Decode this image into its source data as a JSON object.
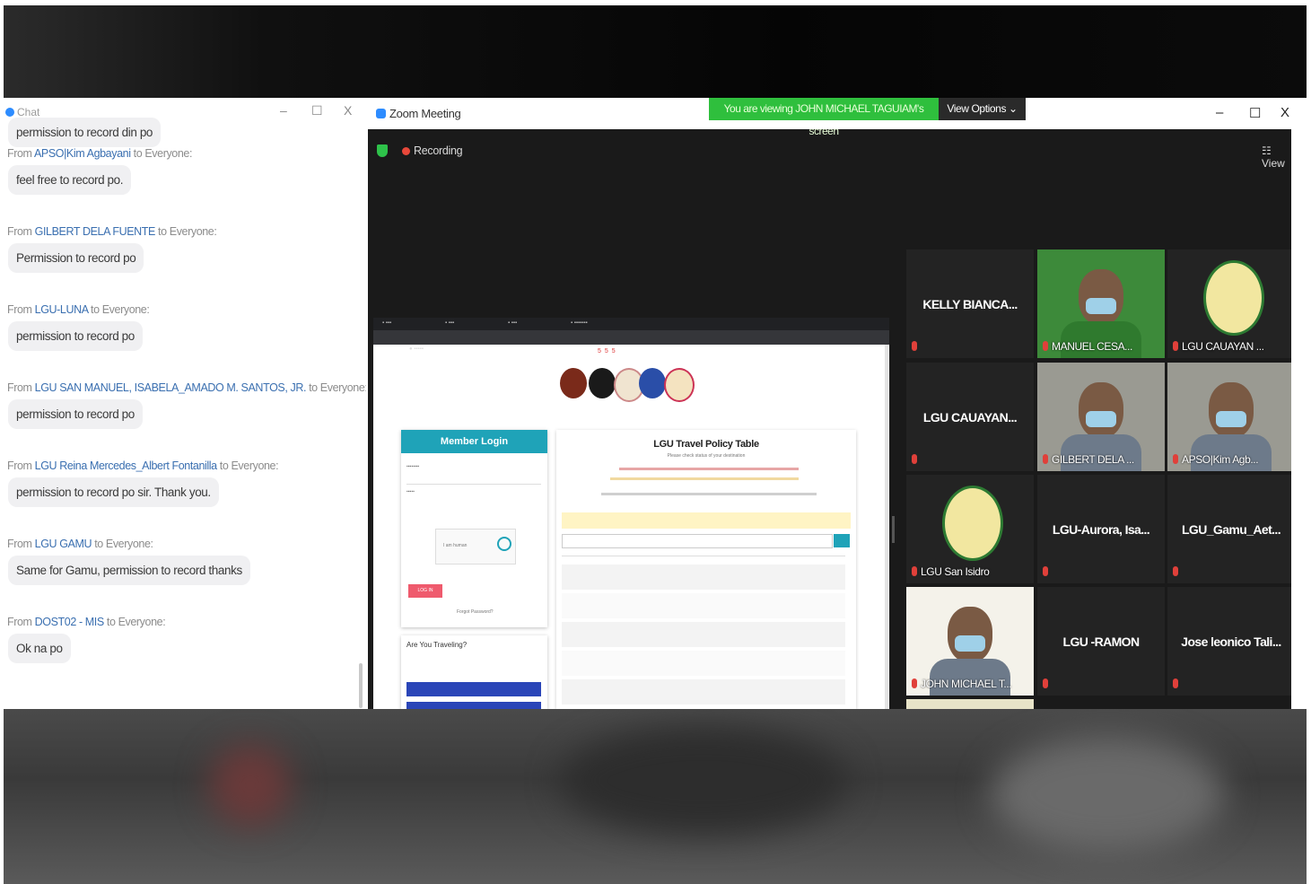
{
  "chat": {
    "title": "Chat",
    "first_bubble": "permission to record din po",
    "messages": [
      {
        "prefix": "From ",
        "sender": "APSO|Kim Agbayani",
        "suffix": " to Everyone:",
        "text": "feel free to record po."
      },
      {
        "prefix": "From ",
        "sender": "GILBERT DELA FUENTE",
        "suffix": " to Everyone:",
        "text": "Permission to record po"
      },
      {
        "prefix": "From ",
        "sender": "LGU-LUNA",
        "suffix": " to Everyone:",
        "text": "permission to record po"
      },
      {
        "prefix": "From ",
        "sender": "LGU SAN MANUEL, ISABELA_AMADO M. SANTOS, JR.",
        "suffix": " to Everyone:",
        "text": "permission to record po"
      },
      {
        "prefix": "From ",
        "sender": "LGU Reina Mercedes_Albert Fontanilla",
        "suffix": " to Everyone:",
        "text": "permission to record po sir. Thank you."
      },
      {
        "prefix": "From ",
        "sender": "LGU GAMU",
        "suffix": " to Everyone:",
        "text": "Same for Gamu, permission to record thanks"
      },
      {
        "prefix": "From ",
        "sender": "DOST02 - MIS",
        "suffix": " to Everyone:",
        "text": "Ok na po"
      }
    ]
  },
  "zoom": {
    "title": "Zoom Meeting",
    "viewing_banner": "You are viewing JOHN MICHAEL TAGUIAM's screen",
    "view_options": "View Options ⌄",
    "recording": "Recording",
    "view_label": "☷ View"
  },
  "shared_screen": {
    "login_header": "Member Login",
    "login_button": "LOG IN",
    "forgot": "Forgot Password?",
    "captcha_label": "I am human",
    "travel_question": "Are You Traveling?",
    "policy_title": "LGU Travel Policy Table",
    "policy_subtitle": "Please check status of your destination"
  },
  "participants": [
    {
      "name": "KELLY BIANCA...",
      "kind": "name"
    },
    {
      "name": "MANUEL CESA...",
      "kind": "video"
    },
    {
      "name": "LGU CAUAYAN ...",
      "kind": "logo"
    },
    {
      "name": "LGU CAUAYAN...",
      "kind": "name"
    },
    {
      "name": "GILBERT DELA ...",
      "kind": "video"
    },
    {
      "name": "APSO|Kim Agb...",
      "kind": "video"
    },
    {
      "name": "LGU San Isidro",
      "kind": "logo"
    },
    {
      "name": "LGU-Aurora, Isa...",
      "kind": "name"
    },
    {
      "name": "LGU_Gamu_Aet...",
      "kind": "name"
    },
    {
      "name": "JOHN MICHAEL T...",
      "kind": "video"
    },
    {
      "name": "LGU -RAMON",
      "kind": "name"
    },
    {
      "name": "Jose leonico Tali...",
      "kind": "name"
    }
  ],
  "colors": {
    "banner_green": "#2fbf3d",
    "sender_blue": "#3a6fb0",
    "active_speaker": "#d7e04c",
    "zoom_blue": "#2d8cff"
  }
}
